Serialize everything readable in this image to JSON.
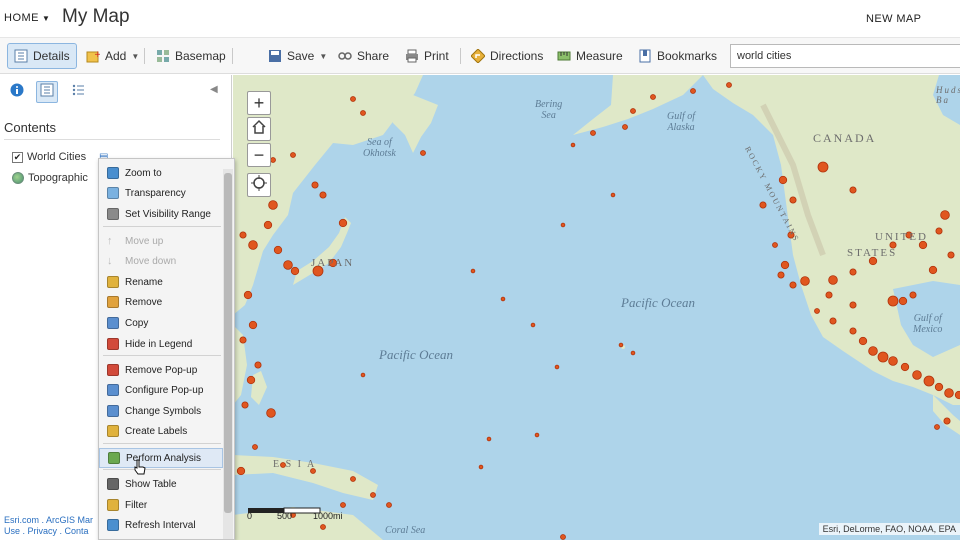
{
  "header": {
    "home_label": "HOME",
    "title": "My Map",
    "new_map_label": "NEW MAP"
  },
  "toolbar": {
    "details_label": "Details",
    "add_label": "Add",
    "basemap_label": "Basemap",
    "save_label": "Save",
    "share_label": "Share",
    "print_label": "Print",
    "directions_label": "Directions",
    "measure_label": "Measure",
    "bookmarks_label": "Bookmarks",
    "search_value": "world cities"
  },
  "left_panel": {
    "contents_heading": "Contents",
    "layers": [
      {
        "label": "World Cities",
        "checked": true
      },
      {
        "label": "Topographic"
      }
    ],
    "footer_line1": "Esri.com . ArcGIS Mar",
    "footer_line2": "Use . Privacy . Conta"
  },
  "context_menu": {
    "items": [
      {
        "label": "Zoom to",
        "icon": "zoom-icon",
        "color": "#4a8fcf"
      },
      {
        "label": "Transparency",
        "icon": "transparency-icon",
        "color": "#7ab1e0"
      },
      {
        "label": "Set Visibility Range",
        "icon": "visibility-range-icon",
        "color": "#8a8a8a"
      },
      {
        "label": "Move up",
        "icon": "arrow-up-icon",
        "disabled": true
      },
      {
        "label": "Move down",
        "icon": "arrow-down-icon",
        "disabled": true
      },
      {
        "label": "Rename",
        "icon": "rename-icon",
        "color": "#e0b23d"
      },
      {
        "label": "Remove",
        "icon": "remove-icon",
        "color": "#e0a23d"
      },
      {
        "label": "Copy",
        "icon": "copy-icon",
        "color": "#5b8fcf"
      },
      {
        "label": "Hide in Legend",
        "icon": "hide-legend-icon",
        "color": "#d24a3a"
      },
      {
        "label": "Remove Pop-up",
        "icon": "remove-popup-icon",
        "color": "#d24a3a"
      },
      {
        "label": "Configure Pop-up",
        "icon": "configure-popup-icon",
        "color": "#5b8fcf"
      },
      {
        "label": "Change Symbols",
        "icon": "change-symbols-icon",
        "color": "#5b8fcf"
      },
      {
        "label": "Create Labels",
        "icon": "create-labels-icon",
        "color": "#e0b23d"
      },
      {
        "label": "Perform Analysis",
        "icon": "analysis-icon",
        "color": "#6aa84f",
        "highlighted": true
      },
      {
        "label": "Show Table",
        "icon": "table-icon",
        "color": "#666"
      },
      {
        "label": "Filter",
        "icon": "filter-icon",
        "color": "#e0b23d"
      },
      {
        "label": "Refresh Interval",
        "icon": "refresh-icon",
        "color": "#4a8fcf"
      }
    ]
  },
  "map": {
    "ocean_labels": [
      "Sea of",
      "Okhotsk",
      "Bering",
      "Sea",
      "Gulf of",
      "Alaska",
      "Pacific Ocean",
      "Pacific Ocean",
      "Coral Sea",
      "Gulf of",
      "Mexico"
    ],
    "land_labels": [
      "CANADA",
      "UNITED",
      "STATES",
      "JAPAN",
      "ROCKY MOUNTAINS",
      "Huds",
      "Ba",
      "E S I A"
    ],
    "scale": {
      "ticks": [
        "0",
        "500",
        "1000mi"
      ]
    },
    "attribution": "Esri, DeLorme, FAO, NOAA, EPA",
    "colors": {
      "ocean": "#aed4ea",
      "land": "#dfe8c8",
      "city": "#e0561f"
    }
  }
}
